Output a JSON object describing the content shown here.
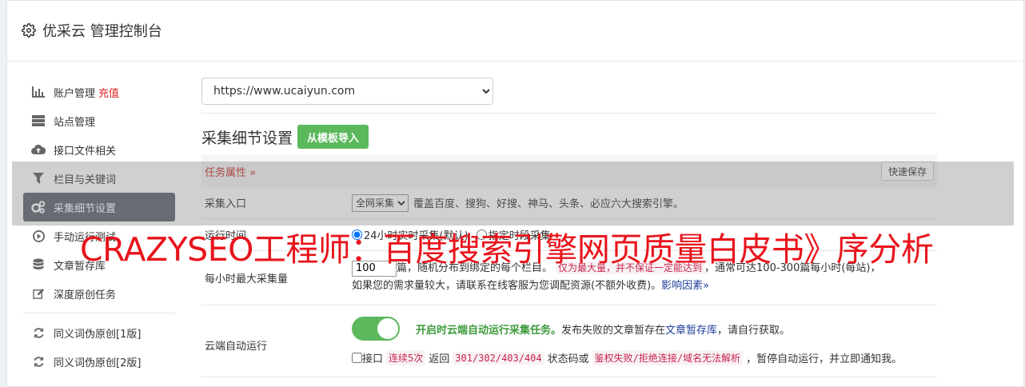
{
  "header": {
    "title": "优采云 管理控制台",
    "icon": "gear-icon"
  },
  "sidebar": {
    "items": [
      {
        "label": "账户管理",
        "extra": "充值",
        "icon": "bar-chart-icon"
      },
      {
        "label": "站点管理",
        "icon": "server-icon"
      },
      {
        "label": "接口文件相关",
        "icon": "cloud-upload-icon"
      },
      {
        "label": "栏目与关键词",
        "icon": "filter-icon"
      },
      {
        "label": "采集细节设置",
        "icon": "cogs-icon",
        "active": true
      },
      {
        "label": "手动运行测试",
        "icon": "play-circle-icon"
      },
      {
        "label": "文章暂存库",
        "icon": "database-icon"
      },
      {
        "label": "深度原创任务",
        "icon": "edit-icon"
      }
    ],
    "items2": [
      {
        "label": "同义词伪原创[1版]",
        "icon": "refresh-icon"
      },
      {
        "label": "同义词伪原创[2版]",
        "icon": "refresh-icon"
      }
    ]
  },
  "site_select": {
    "value": "https://www.ucaiyun.com"
  },
  "section": {
    "title": "采集细节设置",
    "import_button": "从模板导入"
  },
  "task_attr": {
    "label": "任务属性 »",
    "save_button": "快速保存"
  },
  "rows": {
    "entry": {
      "label": "采集入口",
      "select_value": "全网采集",
      "desc": "覆盖百度、搜狗、好搜、神马、头条、必应六大搜索引擎。"
    },
    "runtime": {
      "label": "运行时间",
      "option": "24小时实时采集(默认)",
      "option2": "指定时段采集"
    },
    "max_per_hour": {
      "label": "每小时最大采集量",
      "value": "100",
      "text1": "篇，随机分布到绑定的每个栏目。",
      "badge": "仅为最大量，并不保证一定能达到",
      "text2": "，通常可达100-300篇每小时(每站)，",
      "text3": "如果您的需求量较大，请联系在线客服为您调配资源(不额外收费)。",
      "link": "影响因素»"
    },
    "cloud": {
      "label": "云端自动运行",
      "on_text": "开启时云端自动运行采集任务。",
      "text1": "发布失败的文章暂存在",
      "link": "文章暂存库",
      "text2": "，请自行获取。",
      "line2_a": "接口",
      "code1": "连续5次",
      "line2_b": "返回",
      "code2": "301/302/403/404",
      "line2_c": "状态码或",
      "code3": "鉴权失败/拒绝连接/域名无法解析",
      "line2_d": "，暂停自动运行，并立即通知我。"
    }
  },
  "watermark": "CRAZYSEO工程师：百度搜索引擎网页质量白皮书》序分析",
  "colors": {
    "active_nav": "#5d6472",
    "green": "#5cb85c",
    "red": "#e02020"
  }
}
